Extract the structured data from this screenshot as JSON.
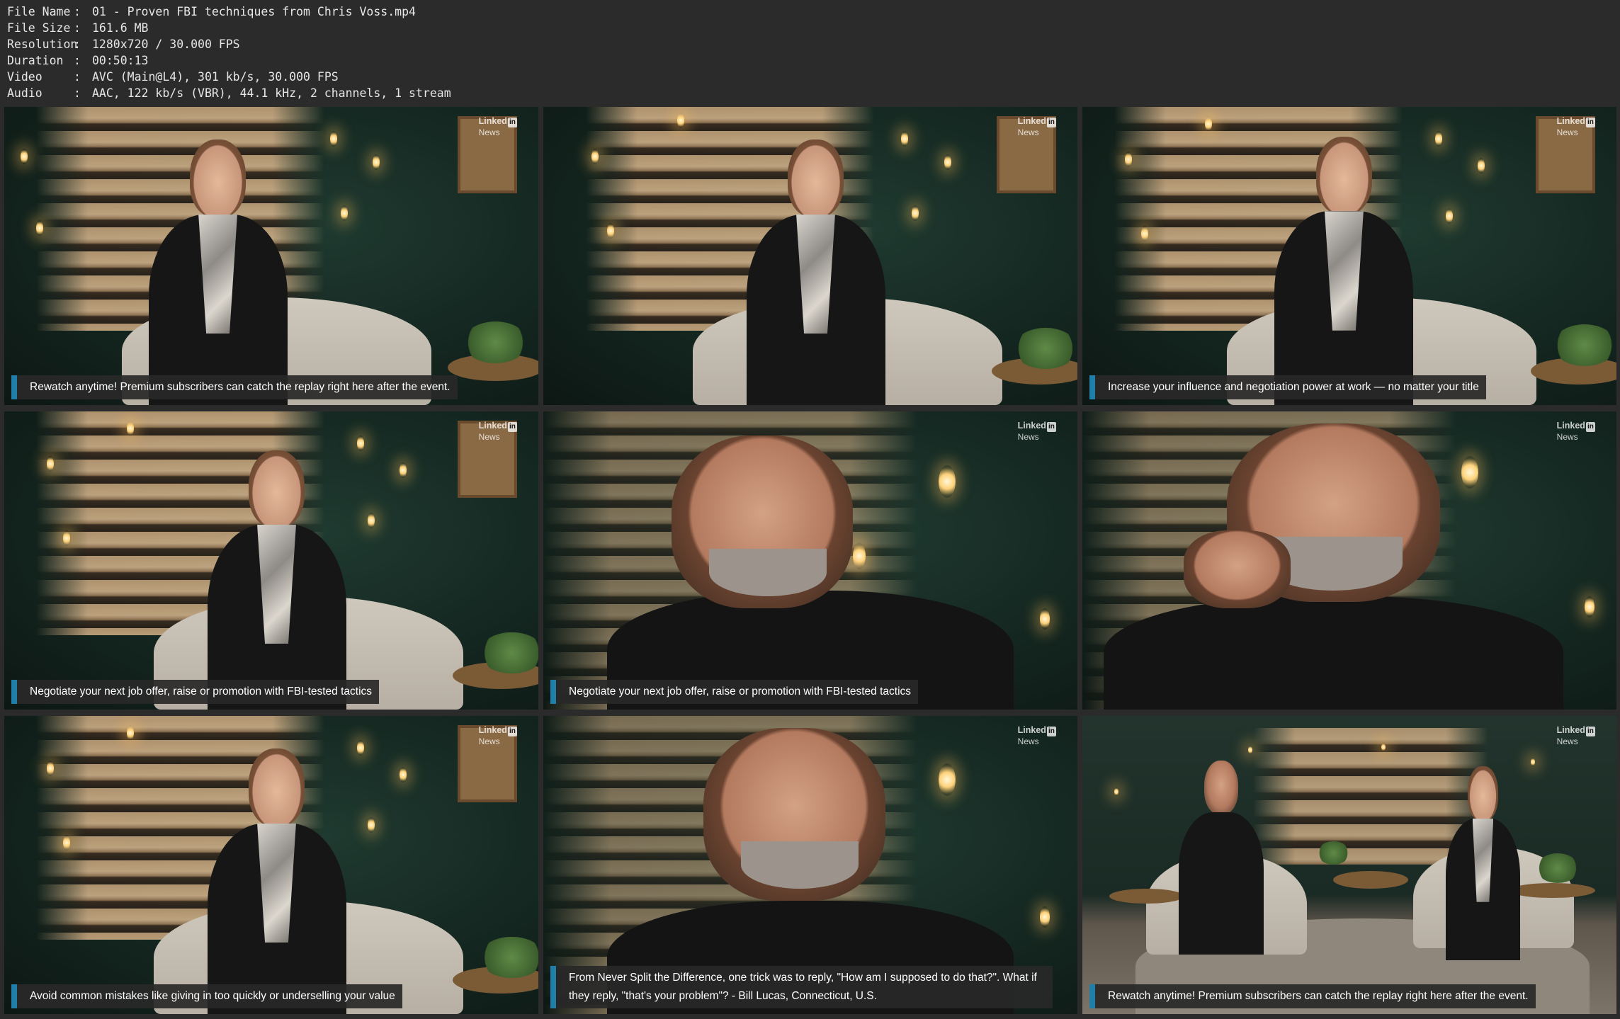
{
  "info": [
    {
      "key": "File Name",
      "sep": ":",
      "value": "01 - Proven FBI techniques from Chris Voss.mp4"
    },
    {
      "key": "File Size",
      "sep": ":",
      "value": "161.6 MB"
    },
    {
      "key": "Resolution",
      "sep": ":",
      "value": "1280x720 / 30.000 FPS"
    },
    {
      "key": "Duration",
      "sep": ":",
      "value": "00:50:13"
    },
    {
      "key": "Video",
      "sep": ":",
      "value": "AVC (Main@L4), 301 kb/s, 30.000 FPS"
    },
    {
      "key": "Audio",
      "sep": ":",
      "value": "AAC, 122 kb/s (VBR), 44.1 kHz, 2 channels, 1 stream"
    }
  ],
  "logo": {
    "brand": "Linked",
    "badge": "in",
    "sub": "News"
  },
  "thumbnails": [
    {
      "scene": "woman",
      "caption": "Rewatch anytime! Premium subscribers can catch the replay right here after the event."
    },
    {
      "scene": "woman",
      "caption": ""
    },
    {
      "scene": "woman",
      "caption": "Increase your influence and negotiation power at work — no matter your title"
    },
    {
      "scene": "woman",
      "caption": "Negotiate your next job offer, raise or promotion with FBI-tested tactics"
    },
    {
      "scene": "man",
      "caption": "Negotiate your next job offer, raise or promotion with FBI-tested tactics"
    },
    {
      "scene": "man",
      "caption": ""
    },
    {
      "scene": "woman",
      "caption": "Avoid common mistakes like giving in too quickly or underselling your value"
    },
    {
      "scene": "man",
      "caption": "From Never Split the Difference, one trick was to reply, \"How am I supposed to do that?\". What if they reply, \"that's your problem\"? - Bill Lucas, Connecticut, U.S."
    },
    {
      "scene": "wide",
      "caption": "Rewatch anytime! Premium subscribers can catch the replay right here after the event."
    }
  ],
  "colors": {
    "background": "#2b2b2b",
    "caption_accent": "#1f7fa8",
    "caption_bg": "#282828"
  }
}
